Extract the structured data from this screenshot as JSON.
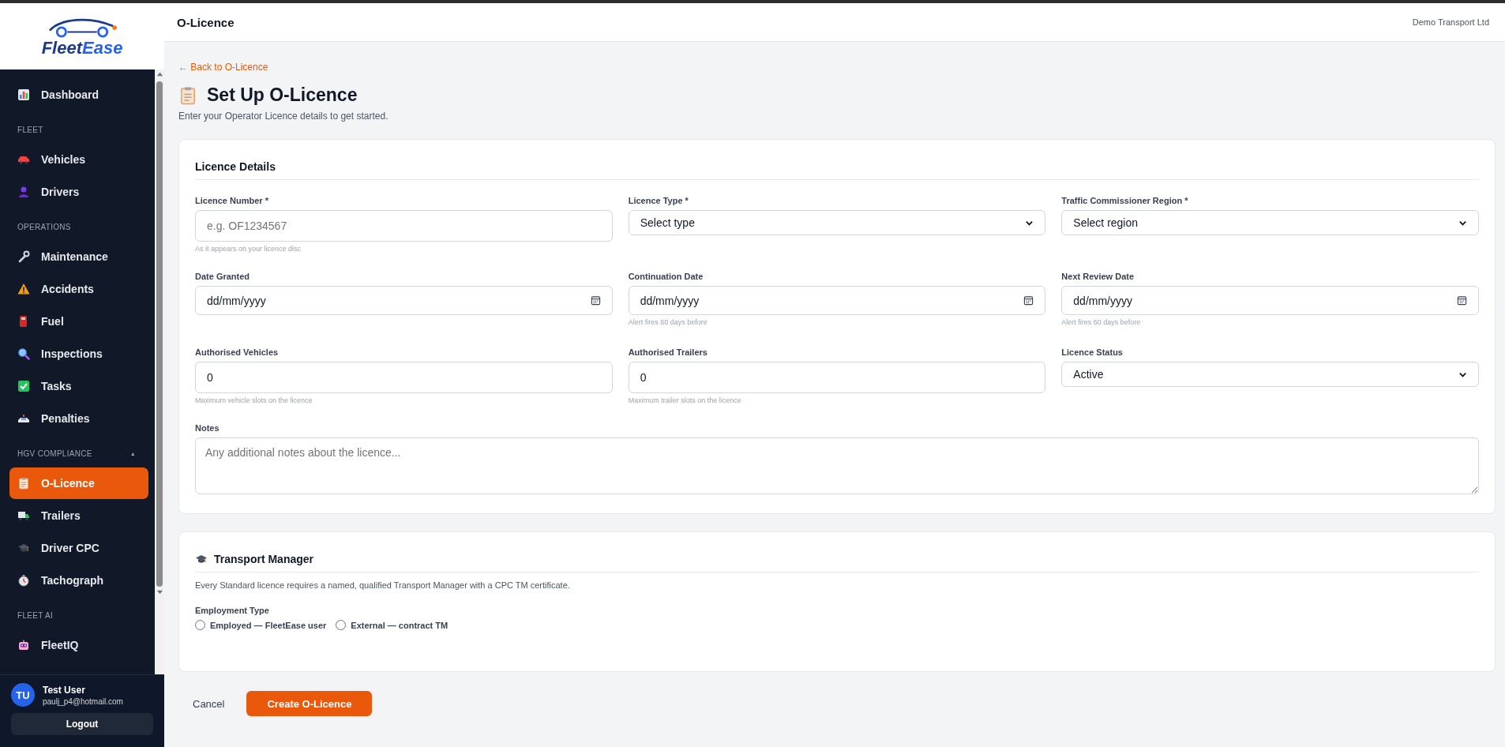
{
  "sidebar": {
    "logo": [
      "Fleet",
      "Ease"
    ],
    "sections": [
      {
        "items": [
          {
            "label": "Dashboard",
            "selected": false
          }
        ]
      },
      {
        "heading": "FLEET",
        "items": [
          {
            "label": "Vehicles",
            "selected": false
          },
          {
            "label": "Drivers",
            "selected": false
          }
        ]
      },
      {
        "heading": "OPERATIONS",
        "items": [
          {
            "label": "Maintenance",
            "selected": false
          },
          {
            "label": "Accidents",
            "selected": false
          },
          {
            "label": "Fuel",
            "selected": false
          },
          {
            "label": "Inspections",
            "selected": false
          },
          {
            "label": "Tasks",
            "selected": false
          },
          {
            "label": "Penalties",
            "selected": false
          }
        ]
      },
      {
        "heading": "HGV COMPLIANCE",
        "caret": "▲",
        "items": [
          {
            "label": "O-Licence",
            "selected": true
          },
          {
            "label": "Trailers",
            "selected": false
          },
          {
            "label": "Driver CPC",
            "selected": false
          },
          {
            "label": "Tachograph",
            "selected": false
          }
        ]
      },
      {
        "heading": "FLEET AI",
        "items": [
          {
            "label": "FleetIQ",
            "selected": false
          }
        ]
      }
    ],
    "user": {
      "initials": "TU",
      "name": "Test User",
      "email": "paulj_p4@hotmail.com"
    },
    "logout": "Logout"
  },
  "header": {
    "title": "O-Licence",
    "company": "Demo Transport Ltd"
  },
  "back_link": "← Back to O-Licence",
  "page_title": "Set Up O-Licence",
  "page_subtitle": "Enter your Operator Licence details to get started.",
  "licence_card": {
    "title": "Licence Details",
    "fields": [
      {
        "kind": "text",
        "label": "Licence Number *",
        "placeholder": "e.g. OF1234567",
        "hint": "As it appears on your licence disc"
      },
      {
        "kind": "select",
        "label": "Licence Type *",
        "value": "Select type"
      },
      {
        "kind": "select",
        "label": "Traffic Commissioner Region *",
        "value": "Select region"
      },
      {
        "kind": "date",
        "label": "Date Granted",
        "format": "dd/mm/yyyy"
      },
      {
        "kind": "date",
        "label": "Continuation Date",
        "format": "dd/mm/yyyy",
        "hint": "Alert fires 60 days before"
      },
      {
        "kind": "date",
        "label": "Next Review Date",
        "format": "dd/mm/yyyy",
        "hint": "Alert fires 60 days before"
      },
      {
        "kind": "number",
        "label": "Authorised Vehicles",
        "value": "0",
        "hint": "Maximum vehicle slots on the licence"
      },
      {
        "kind": "number",
        "label": "Authorised Trailers",
        "value": "0",
        "hint": "Maximum trailer slots on the licence"
      },
      {
        "kind": "select",
        "label": "Licence Status",
        "value": "Active"
      }
    ],
    "notes": {
      "label": "Notes",
      "placeholder": "Any additional notes about the licence..."
    }
  },
  "tm_card": {
    "title": "Transport Manager",
    "description": "Every Standard licence requires a named, qualified Transport Manager with a CPC TM certificate.",
    "employment": {
      "label": "Employment Type",
      "options": [
        {
          "label": "Employed — FleetEase user",
          "selected": false
        },
        {
          "label": "External — contract TM",
          "selected": false
        }
      ]
    }
  },
  "actions": {
    "cancel": "Cancel",
    "submit": "Create O-Licence"
  }
}
